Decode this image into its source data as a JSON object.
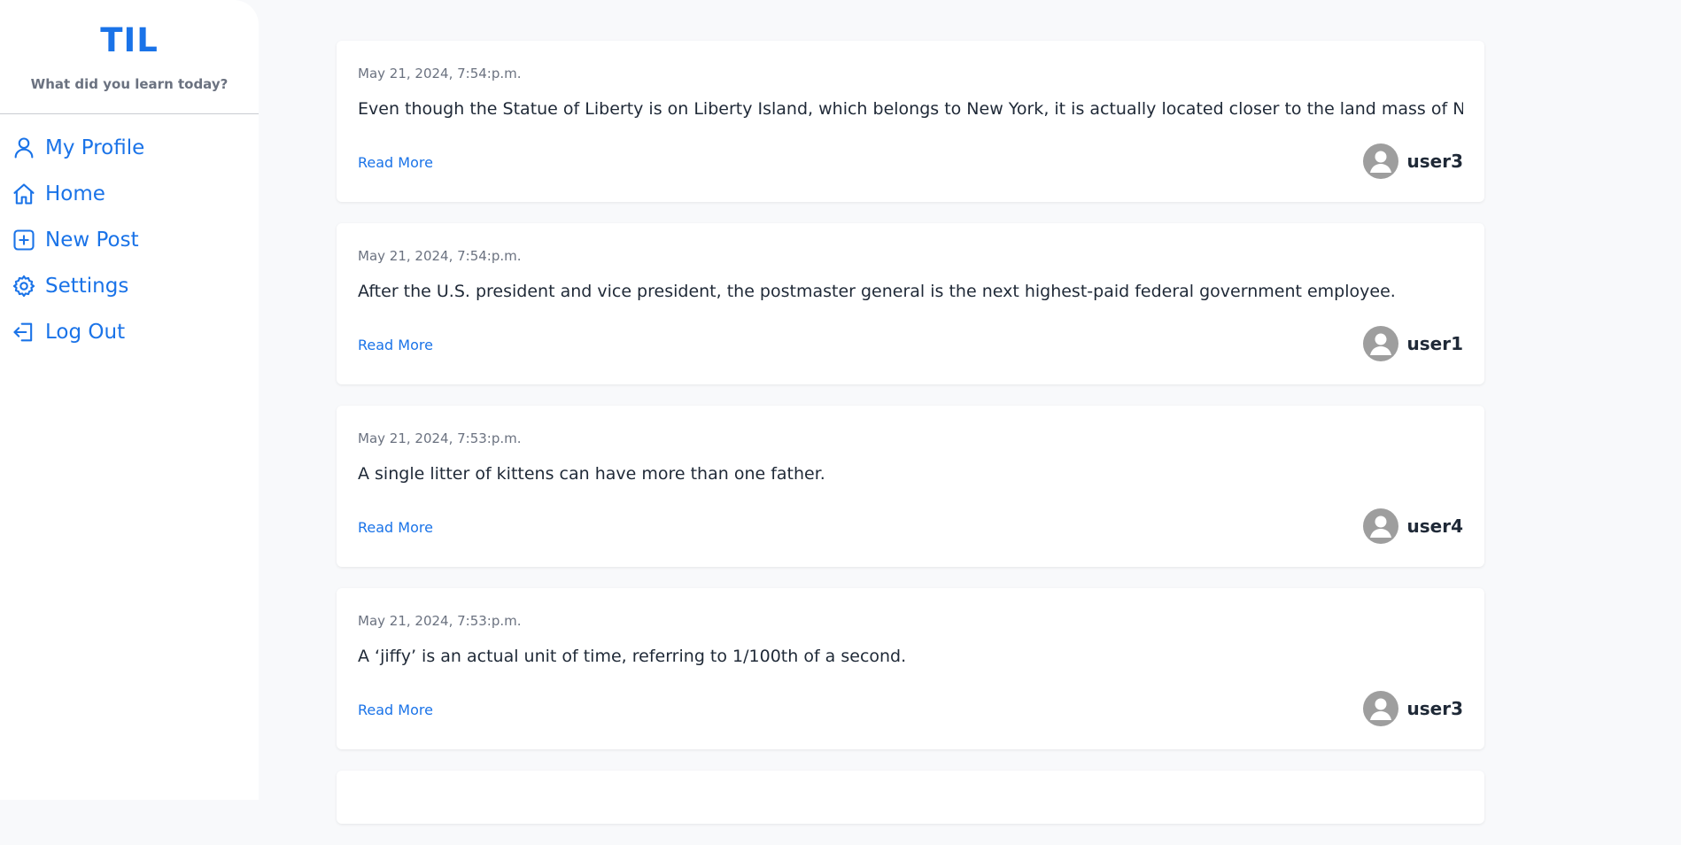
{
  "brand": {
    "title": "TIL",
    "subtitle": "What did you learn today?"
  },
  "nav": [
    {
      "label": "My Profile",
      "icon": "user-icon"
    },
    {
      "label": "Home",
      "icon": "home-icon"
    },
    {
      "label": "New Post",
      "icon": "plus-square-icon"
    },
    {
      "label": "Settings",
      "icon": "gear-icon"
    },
    {
      "label": "Log Out",
      "icon": "logout-icon"
    }
  ],
  "posts": [
    {
      "date": "May 21, 2024, 7:54:p.m.",
      "text": "Even though the Statue of Liberty is on Liberty Island, which belongs to New York, it is actually located closer to the land mass of New Jer",
      "read_more": "Read More",
      "user": "user3"
    },
    {
      "date": "May 21, 2024, 7:54:p.m.",
      "text": "After the U.S. president and vice president, the postmaster general is the next highest-paid federal government employee.",
      "read_more": "Read More",
      "user": "user1"
    },
    {
      "date": "May 21, 2024, 7:53:p.m.",
      "text": "A single litter of kittens can have more than one father.",
      "read_more": "Read More",
      "user": "user4"
    },
    {
      "date": "May 21, 2024, 7:53:p.m.",
      "text": "A ‘jiffy’ is an actual unit of time, referring to 1/100th of a second.",
      "read_more": "Read More",
      "user": "user3"
    }
  ],
  "colors": {
    "accent": "#1a73e8",
    "background": "#f8f9fb",
    "avatar": "#9e9e9e"
  }
}
